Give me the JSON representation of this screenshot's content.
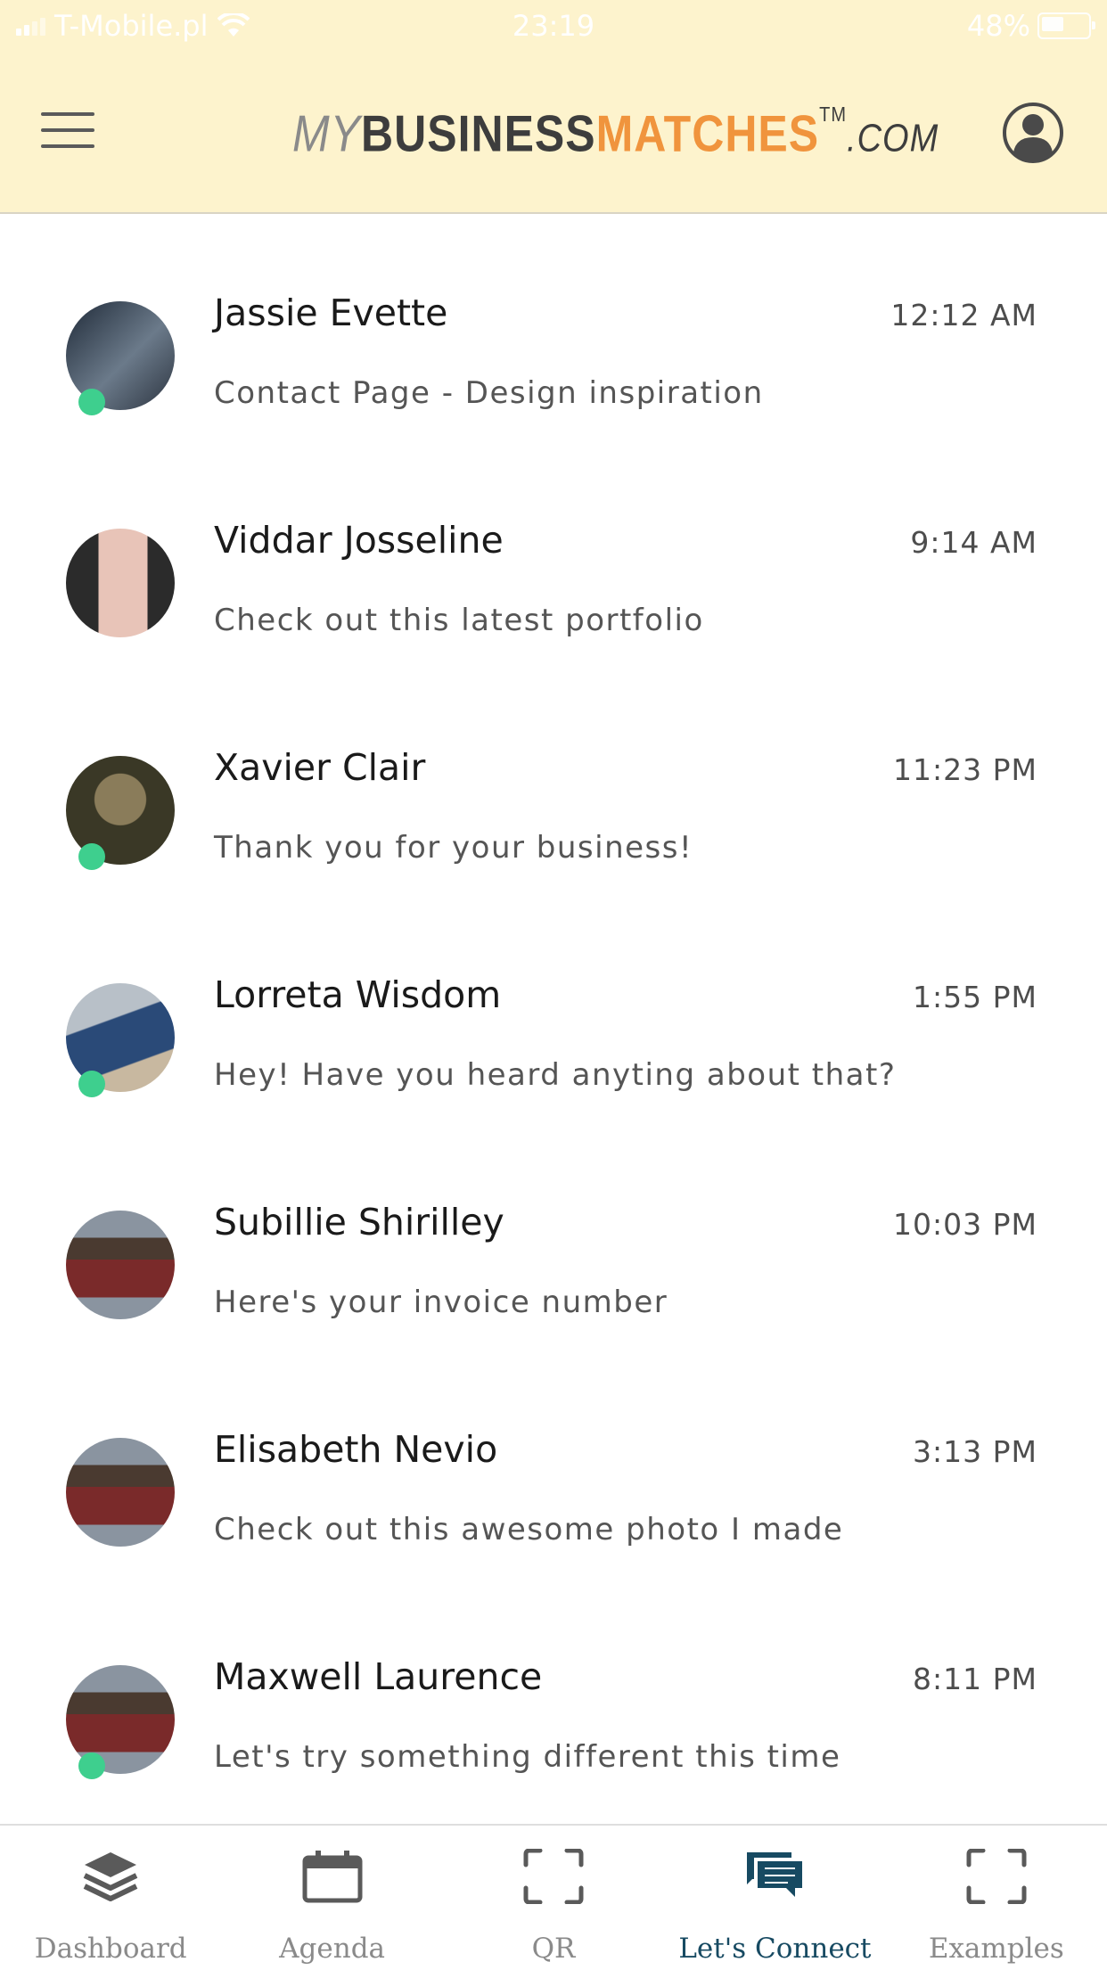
{
  "status_bar": {
    "carrier": "T-Mobile.pl",
    "time": "23:19",
    "battery": "48%"
  },
  "header": {
    "logo": {
      "my": "MY",
      "business": "BUSINESS",
      "matches": "MATCHES",
      "tm": "TM",
      "com": ".COM"
    },
    "menu_icon": "hamburger-icon",
    "profile_icon": "user-circle-icon"
  },
  "conversations": [
    {
      "name": "Jassie Evette",
      "time": "12:12 AM",
      "preview": "Contact Page - Design inspiration",
      "online": true,
      "avatar_colors": [
        "#1f2a38",
        "#6b7a8a"
      ]
    },
    {
      "name": "Viddar Josseline",
      "time": "9:14 AM",
      "preview": "Check out this latest portfolio",
      "online": false,
      "avatar_colors": [
        "#e8c4b8",
        "#2b2b2b"
      ]
    },
    {
      "name": "Xavier Clair",
      "time": "11:23 PM",
      "preview": "Thank you for your business!",
      "online": true,
      "avatar_colors": [
        "#3a3826",
        "#8a7c5a"
      ]
    },
    {
      "name": "Lorreta Wisdom",
      "time": "1:55 PM",
      "preview": "Hey! Have you heard anyting about that?",
      "online": true,
      "avatar_colors": [
        "#2a4a78",
        "#b8c0c8"
      ]
    },
    {
      "name": "Subillie Shirilley",
      "time": "10:03 PM",
      "preview": "Here's your invoice number",
      "online": false,
      "avatar_colors": [
        "#7a2a2a",
        "#8a94a0"
      ]
    },
    {
      "name": "Elisabeth Nevio",
      "time": "3:13 PM",
      "preview": "Check out this awesome photo I made",
      "online": false,
      "avatar_colors": [
        "#7a2a2a",
        "#8a94a0"
      ]
    },
    {
      "name": "Maxwell Laurence",
      "time": "8:11 PM",
      "preview": "Let's try something different this time",
      "online": true,
      "avatar_colors": [
        "#7a2a2a",
        "#8a94a0"
      ]
    }
  ],
  "tabs": [
    {
      "label": "Dashboard",
      "icon": "layers-icon",
      "active": false
    },
    {
      "label": "Agenda",
      "icon": "calendar-icon",
      "active": false
    },
    {
      "label": "QR",
      "icon": "scan-frame-icon",
      "active": false
    },
    {
      "label": "Let's Connect",
      "icon": "chat-bubbles-icon",
      "active": true
    },
    {
      "label": "Examples",
      "icon": "scan-frame-icon",
      "active": false
    }
  ],
  "colors": {
    "header_bg": "#fdf3cd",
    "online": "#3ecf8e",
    "active_tab": "#174a62",
    "inactive_tab": "#8a8a8a",
    "logo_orange": "#f0943d"
  }
}
